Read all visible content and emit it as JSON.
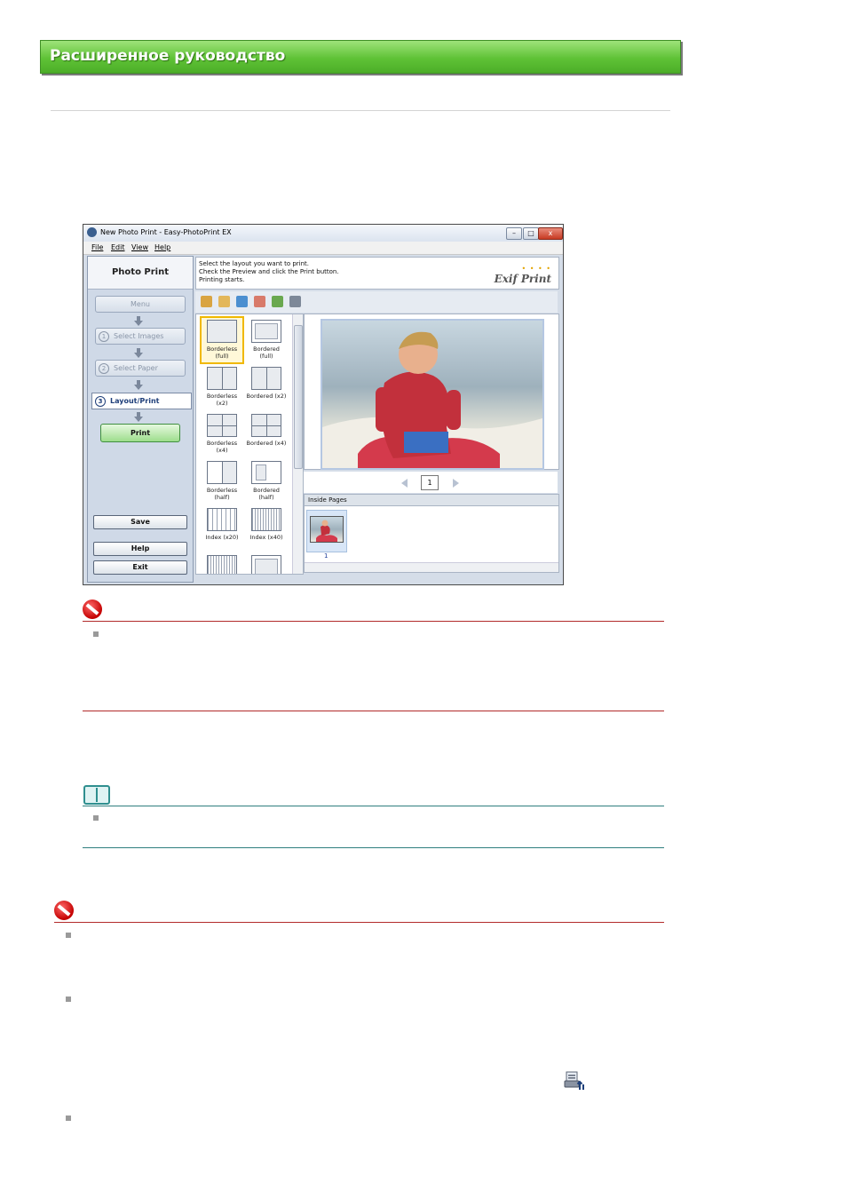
{
  "header": {
    "title": "Расширенное руководство"
  },
  "window": {
    "title": "New Photo Print - Easy-PhotoPrint EX",
    "controls": {
      "minimize": "–",
      "maximize": "□",
      "close": "x"
    },
    "menu": [
      "File",
      "Edit",
      "View",
      "Help"
    ]
  },
  "sidebar": {
    "heading": "Photo Print",
    "menu_label": "Menu",
    "steps": [
      {
        "num": "1",
        "label": "Select Images"
      },
      {
        "num": "2",
        "label": "Select Paper"
      },
      {
        "num": "3",
        "label": "Layout/Print"
      }
    ],
    "print_label": "Print",
    "save_label": "Save",
    "help_label": "Help",
    "exit_label": "Exit"
  },
  "instructions": {
    "line1": "Select the layout you want to print.",
    "line2": "Check the Preview and click the Print button.",
    "line3": "Printing starts.",
    "logo_text": "Exif Print",
    "logo_dots": "• • • •"
  },
  "layouts": [
    {
      "label": "Borderless\n(full)",
      "type": "full",
      "selected": true
    },
    {
      "label": "Bordered (full)",
      "type": "bordered",
      "selected": false
    },
    {
      "label": "Borderless\n(x2)",
      "type": "v2",
      "selected": false
    },
    {
      "label": "Bordered (x2)",
      "type": "bv2",
      "selected": false
    },
    {
      "label": "Borderless\n(x4)",
      "type": "x4",
      "selected": false
    },
    {
      "label": "Bordered (x4)",
      "type": "bx4",
      "selected": false
    },
    {
      "label": "Borderless\n(half)",
      "type": "half",
      "selected": false
    },
    {
      "label": "Bordered\n(half)",
      "type": "bhalf",
      "selected": false
    },
    {
      "label": "Index (x20)",
      "type": "grid",
      "selected": false
    },
    {
      "label": "Index (x40)",
      "type": "grid2",
      "selected": false
    }
  ],
  "pager": {
    "page": "1"
  },
  "inside_pages": {
    "label": "Inside Pages",
    "thumb_num": "1"
  },
  "colors": {
    "banner": "#5fc236",
    "accent_red": "#b22a2a",
    "accent_teal": "#2f7f7f",
    "selected_outline": "#f0b800"
  }
}
